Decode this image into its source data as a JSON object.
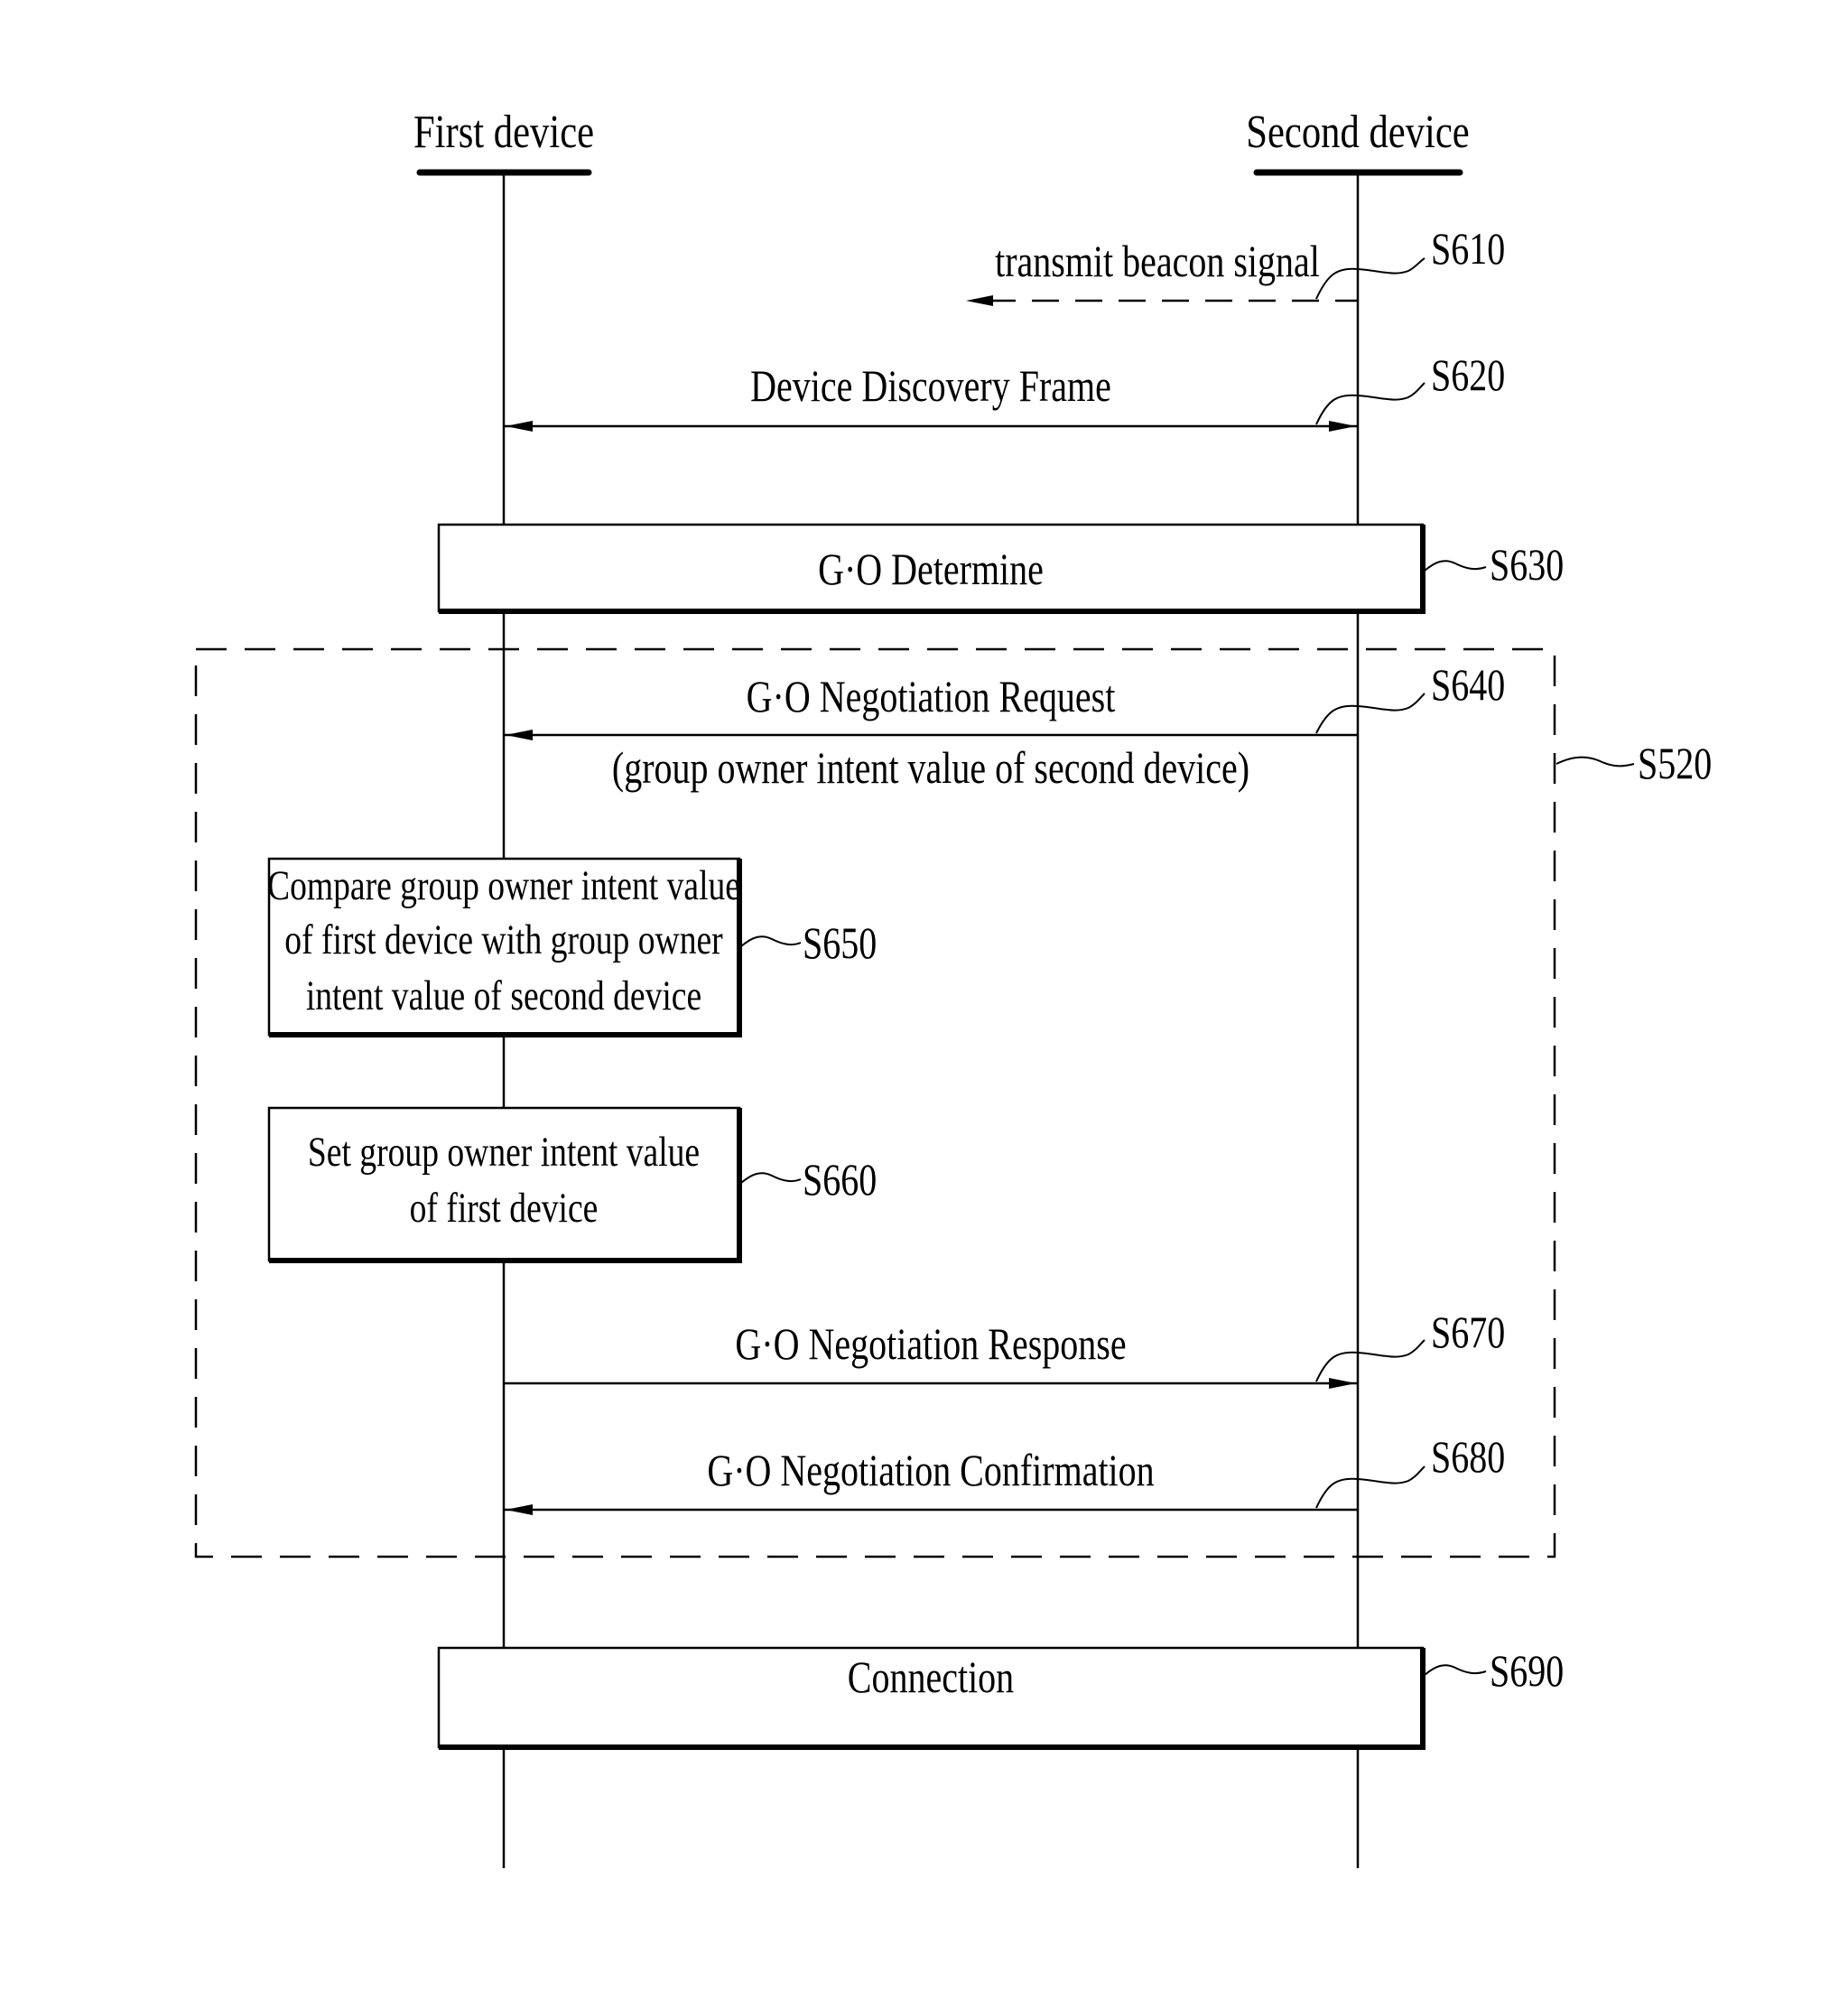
{
  "participants": {
    "first": {
      "label": "First device"
    },
    "second": {
      "label": "Second device"
    }
  },
  "steps": {
    "s610": {
      "id": "S610",
      "label": "transmit beacon signal",
      "from": "second",
      "direction": "outward-left",
      "style": "dashed"
    },
    "s620": {
      "id": "S620",
      "label": "Device Discovery Frame",
      "from": "both",
      "direction": "bidirectional",
      "style": "solid"
    },
    "s630": {
      "id": "S630",
      "label": "G·O Determine",
      "type": "process-box"
    },
    "s640": {
      "id": "S640",
      "label": "G·O Negotiation Request",
      "sublabel": "(group owner intent value of second device)",
      "from": "second",
      "to": "first",
      "style": "solid"
    },
    "s650": {
      "id": "S650",
      "lines": [
        "Compare group owner intent value",
        "of first device with group owner",
        "intent value of second device"
      ],
      "type": "process-box",
      "actor": "first"
    },
    "s660": {
      "id": "S660",
      "lines": [
        "Set group owner intent value",
        "of first device"
      ],
      "type": "process-box",
      "actor": "first"
    },
    "s670": {
      "id": "S670",
      "label": "G·O Negotiation Response",
      "from": "first",
      "to": "second",
      "style": "solid"
    },
    "s680": {
      "id": "S680",
      "label": "G·O Negotiation Confirmation",
      "from": "second",
      "to": "first",
      "style": "solid"
    },
    "s690": {
      "id": "S690",
      "label": "Connection",
      "type": "process-box"
    }
  },
  "group": {
    "id": "S520",
    "contains": [
      "S640",
      "S650",
      "S660",
      "S670",
      "S680"
    ],
    "style": "dashed-box"
  }
}
